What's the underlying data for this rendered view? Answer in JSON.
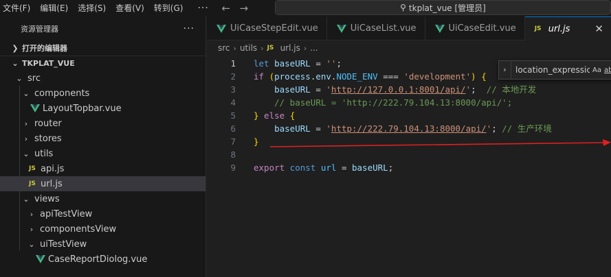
{
  "titlebar": {
    "menus": [
      "文件(F)",
      "编辑(E)",
      "选择(S)",
      "查看(V)",
      "转到(G)"
    ],
    "more": "···",
    "back_icon": "arrow-left-icon",
    "forward_icon": "arrow-right-icon",
    "command_center": "tkplat_vue [管理员]"
  },
  "sidebar": {
    "title": "资源管理器",
    "more": "···",
    "open_editors": "打开的编辑器",
    "project": "TKPLAT_VUE",
    "tree": {
      "src": "src",
      "components": "components",
      "layout_topbar": "LayoutTopbar.vue",
      "router": "router",
      "stores": "stores",
      "utils": "utils",
      "api_js": "api.js",
      "url_js": "url.js",
      "views": "views",
      "api_test_view": "apiTestView",
      "components_view": "componentsView",
      "ui_test_view": "uiTestView",
      "case_report": "CaseReportDiolog.vue"
    },
    "js_badge": "JS"
  },
  "tabs": [
    {
      "label": "UiCaseStepEdit.vue"
    },
    {
      "label": "UiCaseList.vue"
    },
    {
      "label": "UiCaseEdit.vue"
    },
    {
      "label": "url.js",
      "close": "✕"
    }
  ],
  "breadcrumb": {
    "src": "src",
    "utils": "utils",
    "file": "url.js",
    "more": "..."
  },
  "find": {
    "value": "location_expressic",
    "case_opt": "Aa",
    "word_opt": "ab"
  },
  "code": {
    "line_numbers": [
      "1",
      "2",
      "3",
      "4",
      "5",
      "6",
      "7",
      "8",
      "9"
    ],
    "l1": {
      "kw": "let",
      "var": "baseURL",
      "op": " = ",
      "str": "''",
      "end": ";"
    },
    "l2": {
      "kw": "if",
      "open": " (",
      "obj": "process",
      "dot1": ".",
      "env": "env",
      "dot2": ".",
      "cst": "NODE_ENV",
      "op": " === ",
      "str": "'development'",
      "close": ") ",
      "brace": "{"
    },
    "l3": {
      "var": "baseURL",
      "op": " = ",
      "q1": "'",
      "url": "http://127.0.0.1:8001/api/",
      "q2": "'",
      "semi": ";  ",
      "cmt": "// 本地开发"
    },
    "l4": {
      "cmt": "// baseURL = 'http://222.79.104.13:8000/api/';"
    },
    "l5": {
      "brace": "}",
      "kw": " else ",
      "brace2": "{"
    },
    "l6": {
      "var": "baseURL",
      "op": " = ",
      "q1": "'",
      "url": "http://222.79.104.13:8000/api/",
      "q2": "'",
      "semi": "; ",
      "cmt": "// 生产环境"
    },
    "l7": {
      "brace": "}"
    },
    "l8": {},
    "l9": {
      "kw": "export",
      "kw2": " const ",
      "var": "url",
      "op": " = ",
      "var2": "baseURL",
      "end": ";"
    }
  },
  "colors": {
    "arrow": "#e02020",
    "accent": "#0078d4",
    "vue_green": "#41b883",
    "js_yellow": "#cbcb41"
  }
}
